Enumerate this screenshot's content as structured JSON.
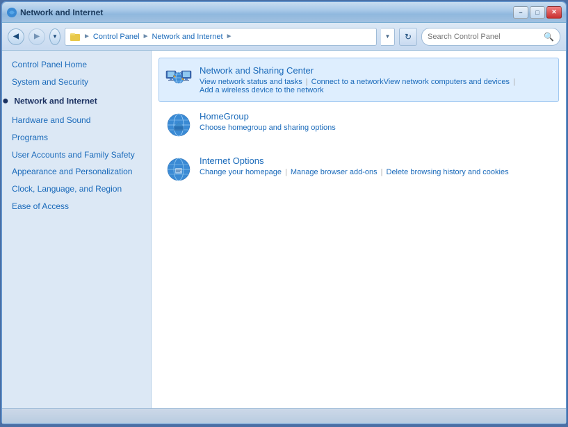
{
  "window": {
    "title": "Network and Internet",
    "controls": {
      "minimize": "–",
      "maximize": "□",
      "close": "✕"
    }
  },
  "nav": {
    "back_title": "Back",
    "forward_title": "Forward",
    "breadcrumb": [
      {
        "label": "Control Panel",
        "link": true
      },
      {
        "label": "Network and Internet",
        "link": true
      }
    ],
    "refresh_symbol": "↻",
    "search_placeholder": "Search Control Panel"
  },
  "sidebar": {
    "items": [
      {
        "label": "Control Panel Home",
        "active": false,
        "bullet": false
      },
      {
        "label": "System and Security",
        "active": false,
        "bullet": false
      },
      {
        "label": "Network and Internet",
        "active": true,
        "bullet": true
      },
      {
        "label": "Hardware and Sound",
        "active": false,
        "bullet": false
      },
      {
        "label": "Programs",
        "active": false,
        "bullet": false
      },
      {
        "label": "User Accounts and Family Safety",
        "active": false,
        "bullet": false
      },
      {
        "label": "Appearance and Personalization",
        "active": false,
        "bullet": false
      },
      {
        "label": "Clock, Language, and Region",
        "active": false,
        "bullet": false
      },
      {
        "label": "Ease of Access",
        "active": false,
        "bullet": false
      }
    ]
  },
  "content": {
    "items": [
      {
        "id": "network-sharing",
        "title": "Network and Sharing Center",
        "links": [
          {
            "label": "View network status and tasks"
          },
          {
            "label": "Connect to a network"
          },
          {
            "label": "View network computers and devices"
          },
          {
            "label": "Add a wireless device to the network"
          }
        ],
        "highlighted": true
      },
      {
        "id": "homegroup",
        "title": "HomeGroup",
        "links": [
          {
            "label": "Choose homegroup and sharing options"
          }
        ],
        "highlighted": false
      },
      {
        "id": "internet-options",
        "title": "Internet Options",
        "links": [
          {
            "label": "Change your homepage"
          },
          {
            "label": "Manage browser add-ons"
          },
          {
            "label": "Delete browsing history and cookies"
          }
        ],
        "highlighted": false
      }
    ]
  }
}
